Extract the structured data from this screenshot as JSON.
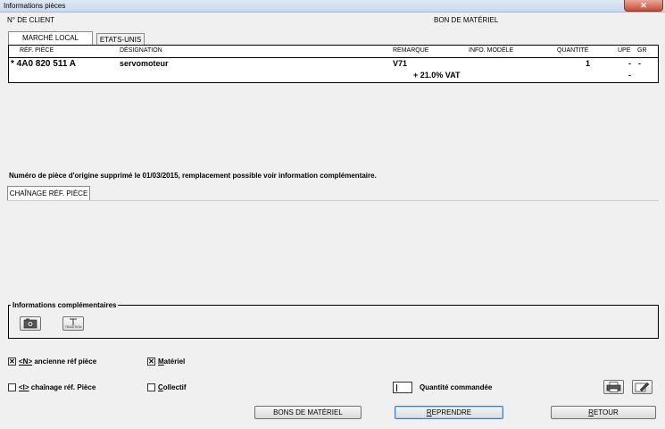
{
  "window": {
    "title": "Informations pièces",
    "close_label": "✕"
  },
  "header": {
    "client_label": "N° DE CLIENT",
    "bon_label": "BON DE MATÉRIEL"
  },
  "tabs": [
    {
      "label": "MARCHÉ LOCAL"
    },
    {
      "label": "ETATS-UNIS"
    }
  ],
  "grid": {
    "columns": [
      "RÉF. PIÈCE",
      "DÉSIGNATION",
      "REMARQUE",
      "INFO. MODÈLE",
      "QUANTITÉ",
      "UPE",
      "GR"
    ],
    "rows": [
      {
        "ref": "* 4A0 820 511 A",
        "designation": "servomoteur",
        "remarque": "V71",
        "quantite": "1",
        "upe": "-",
        "gr": "-",
        "sub_remark": "+ 21.0% VAT",
        "sub_upe": "-"
      }
    ]
  },
  "notice": "Numéro de pièce d'origine supprimé le 01/03/2015, remplacement possible voir information complémentaire.",
  "chain_tab": {
    "label": "CHAÎNAGE RÉF. PIÈCE"
  },
  "info": {
    "title": "Informations complémentaires",
    "button2_text": "TRADITION"
  },
  "options": {
    "ancienne": {
      "key": "<N>",
      "label": " ancienne réf pièce",
      "checked": "✕"
    },
    "materiel": {
      "key": "M",
      "label": "atériel",
      "checked": "✕"
    },
    "chainage": {
      "key": "<I>",
      "label": " chaînage réf. Pièce",
      "checked": ""
    },
    "collectif": {
      "key": "C",
      "label": "ollectif",
      "checked": ""
    }
  },
  "quantity": {
    "label": "Quantité commandée"
  },
  "buttons": {
    "bons": "BONS DE MATÉRIEL",
    "reprendre_key": "R",
    "reprendre_rest": "EPRENDRE",
    "retour_key": "R",
    "retour_rest": "ETOUR"
  }
}
